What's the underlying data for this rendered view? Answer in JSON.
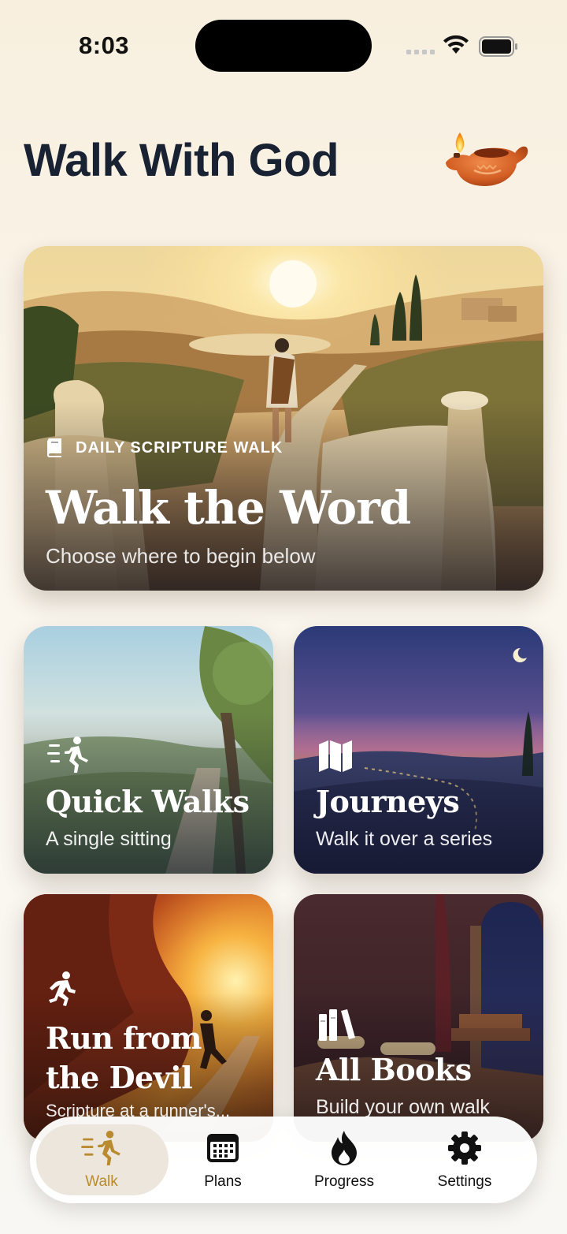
{
  "status_bar": {
    "time": "8:03"
  },
  "header": {
    "title": "Walk With God",
    "icon": "oil-lamp-icon"
  },
  "hero": {
    "eyebrow": "DAILY SCRIPTURE WALK",
    "title": "Walk the Word",
    "subtitle": "Choose where to begin below"
  },
  "tiles": [
    {
      "title": "Quick Walks",
      "subtitle": "A single sitting",
      "icon": "walking-person-icon"
    },
    {
      "title": "Journeys",
      "subtitle": "Walk it over a series",
      "icon": "map-icon"
    },
    {
      "title_line1": "Run from",
      "title_line2": "the Devil",
      "subtitle": "Scripture at a runner's...",
      "icon": "running-person-icon"
    },
    {
      "title": "All Books",
      "subtitle": "Build your own walk",
      "icon": "books-icon"
    }
  ],
  "tab_bar": {
    "items": [
      {
        "label": "Walk",
        "icon": "walk-icon",
        "selected": true
      },
      {
        "label": "Plans",
        "icon": "calendar-icon"
      },
      {
        "label": "Progress",
        "icon": "flame-icon"
      },
      {
        "label": "Settings",
        "icon": "gear-icon"
      }
    ]
  },
  "colors": {
    "accent": "#b98a2e",
    "title": "#182233",
    "background": "#f8efde"
  }
}
